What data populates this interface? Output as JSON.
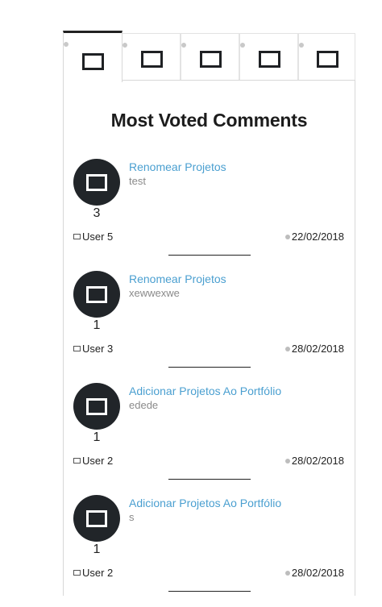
{
  "tabs": [
    {
      "icon": "window-icon",
      "active": true
    },
    {
      "icon": "window-icon",
      "active": false
    },
    {
      "icon": "window-icon",
      "active": false
    },
    {
      "icon": "window-icon",
      "active": false
    },
    {
      "icon": "window-icon",
      "active": false
    }
  ],
  "panel": {
    "title": "Most Voted Comments"
  },
  "comments": [
    {
      "title": "Renomear Projetos",
      "text": "test",
      "votes": "3",
      "author": "User 5",
      "date": "22/02/2018"
    },
    {
      "title": "Renomear Projetos",
      "text": "xewwexwe",
      "votes": "1",
      "author": "User 3",
      "date": "28/02/2018"
    },
    {
      "title": "Adicionar Projetos Ao Portfólio",
      "text": "edede",
      "votes": "1",
      "author": "User 2",
      "date": "28/02/2018"
    },
    {
      "title": "Adicionar Projetos Ao Portfólio",
      "text": "s",
      "votes": "1",
      "author": "User 2",
      "date": "28/02/2018"
    }
  ],
  "colors": {
    "link": "#4a9fd0",
    "avatar_bg": "#212529",
    "muted_text": "#8a8a8a"
  }
}
